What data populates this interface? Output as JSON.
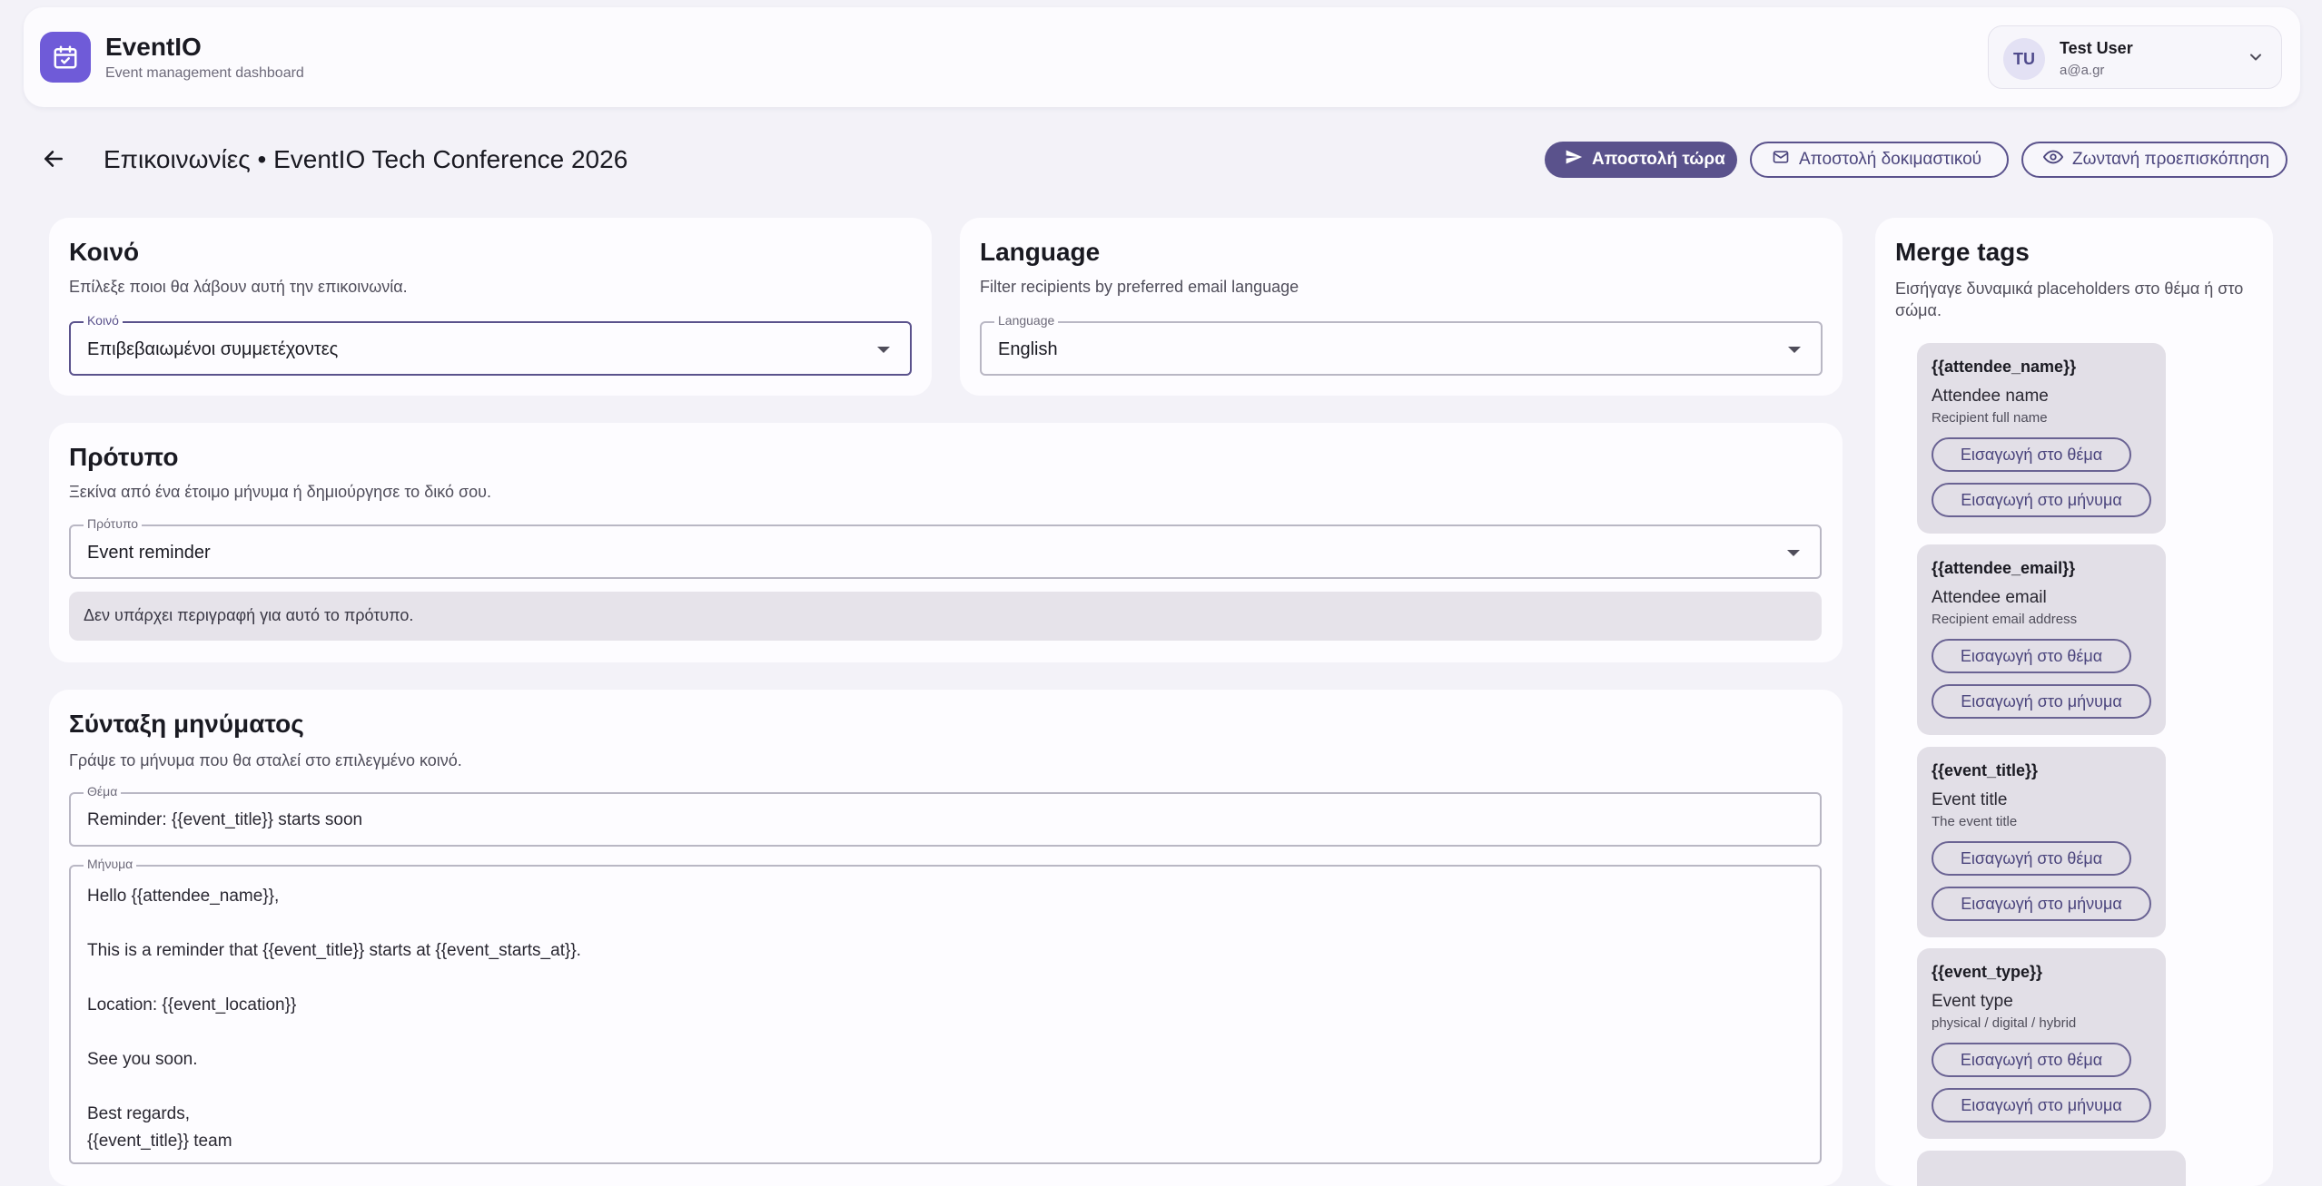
{
  "header": {
    "app_name": "EventIO",
    "app_subtitle": "Event management dashboard",
    "user": {
      "initials": "TU",
      "name": "Test User",
      "email": "a@a.gr"
    }
  },
  "page": {
    "title": "Επικοινωνίες • EventIO Tech Conference 2026",
    "actions": {
      "send_now": "Αποστολή τώρα",
      "send_test": "Αποστολή δοκιμαστικού",
      "live_preview": "Ζωντανή προεπισκόπηση"
    }
  },
  "audience": {
    "title": "Κοινό",
    "description": "Επίλεξε ποιοι θα λάβουν αυτή την επικοινωνία.",
    "field_label": "Κοινό",
    "value": "Επιβεβαιωμένοι συμμετέχοντες"
  },
  "language": {
    "title": "Language",
    "description": "Filter recipients by preferred email language",
    "field_label": "Language",
    "value": "English"
  },
  "template": {
    "title": "Πρότυπο",
    "description": "Ξεκίνα από ένα έτοιμο μήνυμα ή δημιούργησε το δικό σου.",
    "field_label": "Πρότυπο",
    "value": "Event reminder",
    "note": "Δεν υπάρχει περιγραφή για αυτό το πρότυπο."
  },
  "compose": {
    "title": "Σύνταξη μηνύματος",
    "description": "Γράψε το μήνυμα που θα σταλεί στο επιλεγμένο κοινό.",
    "subject_label": "Θέμα",
    "subject_value": "Reminder: {{event_title}} starts soon",
    "message_label": "Μήνυμα",
    "message_value": "Hello {{attendee_name}},\n\nThis is a reminder that {{event_title}} starts at {{event_starts_at}}.\n\nLocation: {{event_location}}\n\nSee you soon.\n\nBest regards,\n{{event_title}} team"
  },
  "merge_tags": {
    "title": "Merge tags",
    "description": "Εισήγαγε δυναμικά placeholders στο θέμα ή στο σώμα.",
    "insert_subject_label": "Εισαγωγή στο θέμα",
    "insert_body_label": "Εισαγωγή στο μήνυμα",
    "tags": [
      {
        "code": "{{attendee_name}}",
        "name": "Attendee name",
        "hint": "Recipient full name"
      },
      {
        "code": "{{attendee_email}}",
        "name": "Attendee email",
        "hint": "Recipient email address"
      },
      {
        "code": "{{event_title}}",
        "name": "Event title",
        "hint": "The event title"
      },
      {
        "code": "{{event_type}}",
        "name": "Event type",
        "hint": "physical / digital / hybrid"
      }
    ]
  },
  "colors": {
    "accent": "#5a528c",
    "logo_bg": "#6f5bd8",
    "page_bg": "#f3f2f8",
    "tag_bg": "#e2dfe7"
  }
}
